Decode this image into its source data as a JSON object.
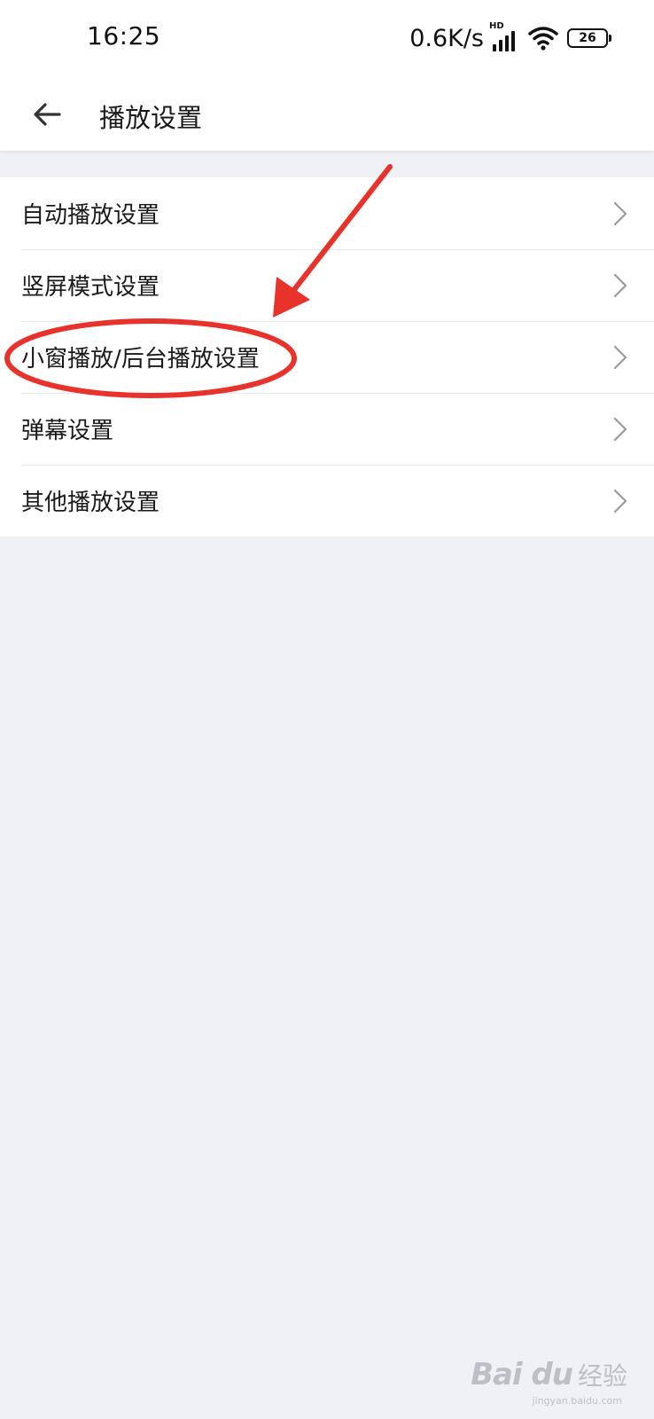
{
  "status_bar": {
    "time": "16:25",
    "net_speed": "0.6K/s",
    "network_badge": "HD",
    "battery_level": "26",
    "icons": [
      "signal-icon",
      "wifi-icon",
      "battery-icon"
    ]
  },
  "nav": {
    "title": "播放设置",
    "back_icon": "arrow-left-icon"
  },
  "settings": {
    "items": [
      {
        "label": "自动播放设置"
      },
      {
        "label": "竖屏模式设置"
      },
      {
        "label": "小窗播放/后台播放设置"
      },
      {
        "label": "弹幕设置"
      },
      {
        "label": "其他播放设置"
      }
    ],
    "chevron_icon": "chevron-right-icon"
  },
  "annotation": {
    "color": "#e8332c",
    "highlighted_item": "小窗播放/后台播放设置"
  },
  "watermark": {
    "logo": "Bai du",
    "text": "经验",
    "sub": "jingyan.baidu.com"
  },
  "colors": {
    "background": "#f0f1f4",
    "surface": "#ffffff",
    "text": "#1a1a1a",
    "chevron": "#9a9a9a"
  }
}
